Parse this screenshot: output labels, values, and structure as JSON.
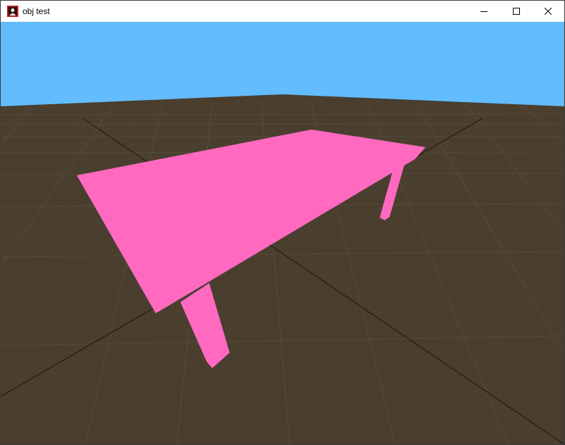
{
  "window": {
    "title": "obj test",
    "icon": "app-icon",
    "controls": {
      "minimize_icon": "minimize-icon",
      "maximize_icon": "maximize-icon",
      "close_icon": "close-icon"
    }
  },
  "scene": {
    "sky_color": "#62bcfd",
    "ground_color": "#4a3e2f",
    "grid_color": "#574b3c",
    "axis_color": "#1a140d",
    "model_color": "#ff69c0"
  }
}
